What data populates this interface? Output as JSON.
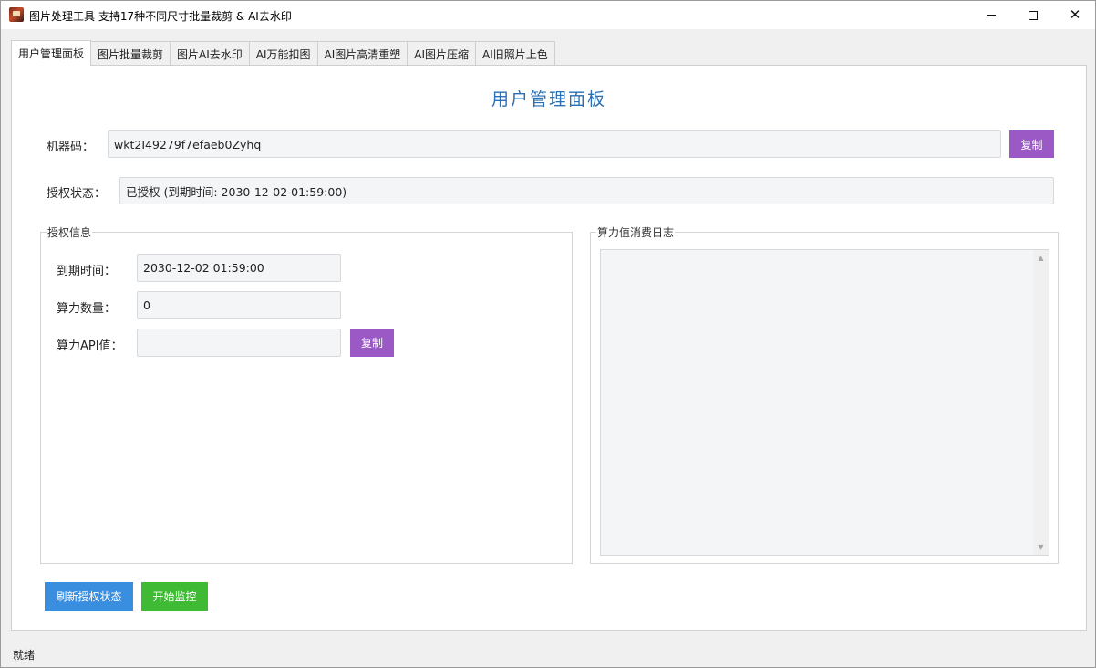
{
  "window": {
    "title": "图片处理工具 支持17种不同尺寸批量裁剪 & AI去水印"
  },
  "tabs": [
    {
      "label": "用户管理面板",
      "active": true
    },
    {
      "label": "图片批量裁剪",
      "active": false
    },
    {
      "label": "图片AI去水印",
      "active": false
    },
    {
      "label": "AI万能扣图",
      "active": false
    },
    {
      "label": "AI图片高清重塑",
      "active": false
    },
    {
      "label": "AI图片压缩",
      "active": false
    },
    {
      "label": "AI旧照片上色",
      "active": false
    }
  ],
  "panel": {
    "heading": "用户管理面板",
    "machine_code": {
      "label": "机器码：",
      "value": "wkt2I49279f7efaeb0Zyhq",
      "copy_label": "复制"
    },
    "auth_status": {
      "label": "授权状态：",
      "value": "已授权 (到期时间: 2030-12-02 01:59:00)"
    },
    "auth_info": {
      "title": "授权信息",
      "expiry": {
        "label": "到期时间：",
        "value": "2030-12-02 01:59:00"
      },
      "credits": {
        "label": "算力数量：",
        "value": "0"
      },
      "api_key": {
        "label": "算力API值：",
        "value": "",
        "copy_label": "复制"
      }
    },
    "log": {
      "title": "算力值消费日志",
      "content": ""
    },
    "refresh_label": "刷新授权状态",
    "monitor_label": "开始监控"
  },
  "status_bar": {
    "text": "就绪"
  },
  "colors": {
    "accent_blue": "#3a8ee0",
    "copy_purple": "#9b59c6",
    "monitor_green": "#3fba35",
    "heading_blue": "#2a6fb3"
  }
}
